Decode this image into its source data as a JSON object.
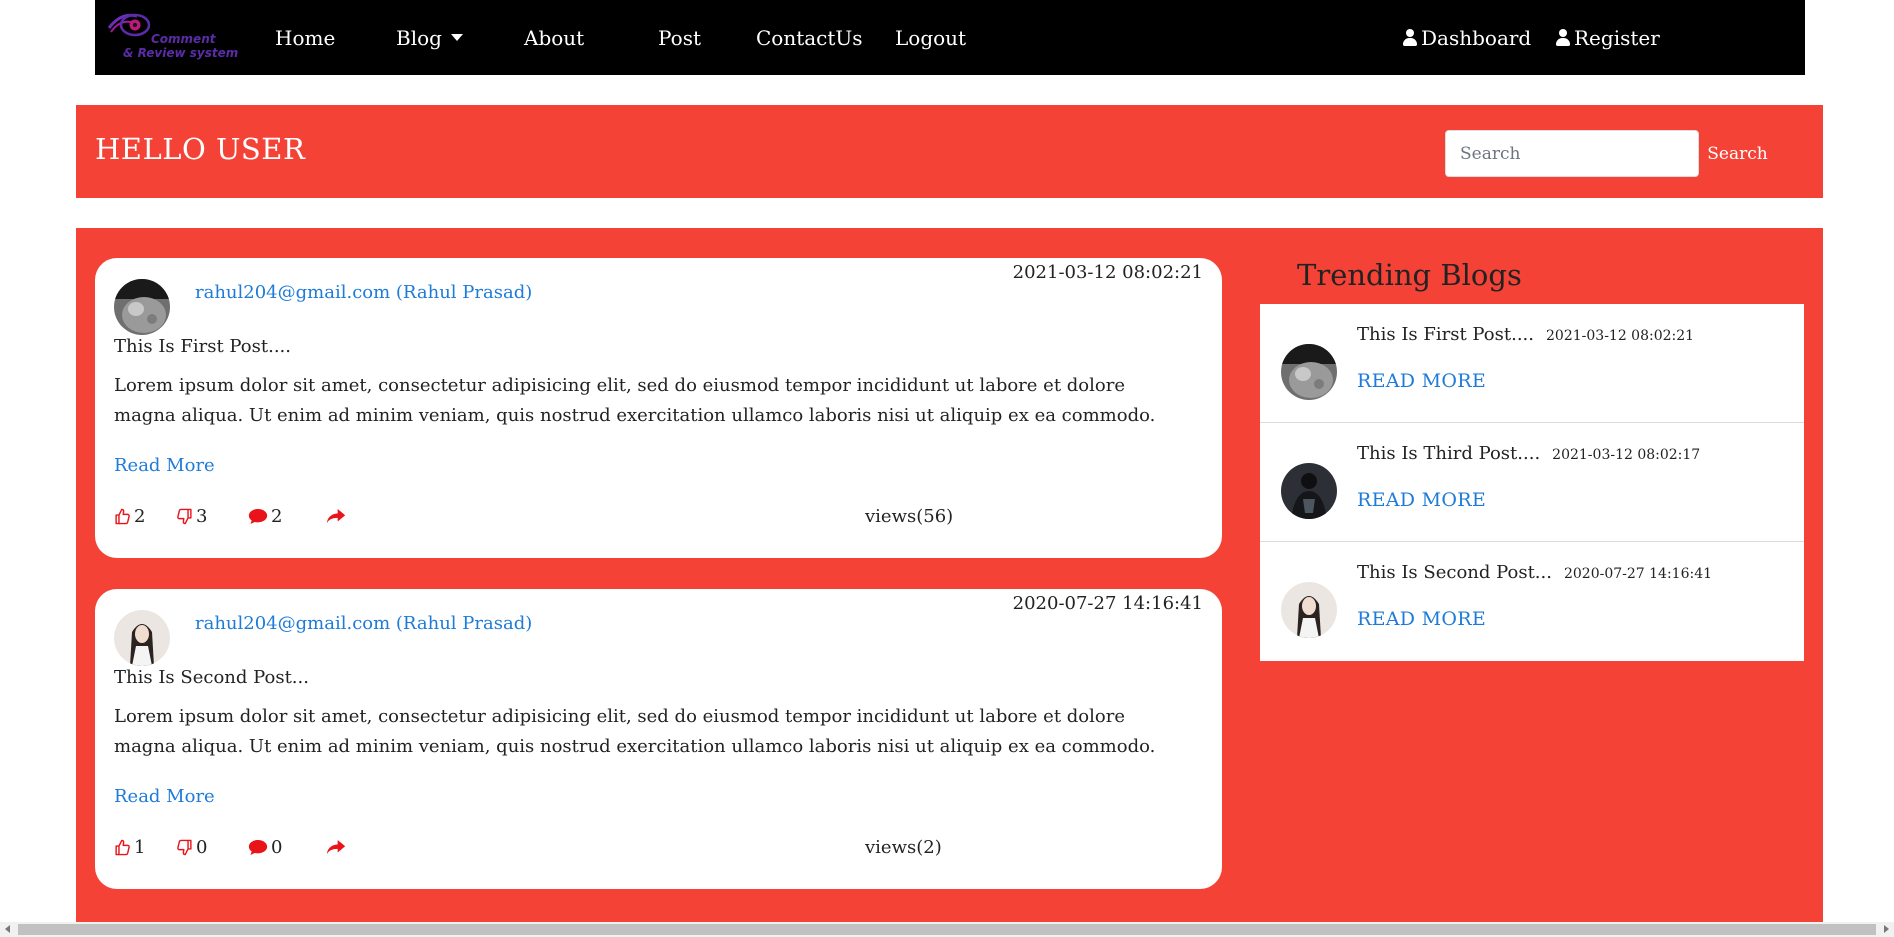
{
  "brand": {
    "line1": "Comment",
    "line2": "& Review system"
  },
  "nav": {
    "home": "Home",
    "blog": "Blog",
    "about": "About",
    "post": "Post",
    "contact": "ContactUs",
    "logout": "Logout",
    "dashboard": "Dashboard",
    "register": "Register"
  },
  "banner": {
    "greeting": "HELLO USER",
    "search_placeholder": "Search",
    "search_button": "Search"
  },
  "posts": [
    {
      "date": "2021-03-12 08:02:21",
      "author": "rahul204@gmail.com  (Rahul Prasad)",
      "title": "This Is First Post....",
      "body": "Lorem ipsum dolor sit amet, consectetur adipisicing elit, sed do eiusmod tempor incididunt ut labore et dolore magna aliqua. Ut enim ad minim veniam, quis nostrud exercitation ullamco laboris nisi ut aliquip ex ea commodo.",
      "read_more": "Read More",
      "likes": "2",
      "dislikes": "3",
      "comments": "2",
      "views": "views(56)"
    },
    {
      "date": "2020-07-27 14:16:41",
      "author": "rahul204@gmail.com  (Rahul Prasad)",
      "title": "This Is Second Post...",
      "body": "Lorem ipsum dolor sit amet, consectetur adipisicing elit, sed do eiusmod tempor incididunt ut labore et dolore magna aliqua. Ut enim ad minim veniam, quis nostrud exercitation ullamco laboris nisi ut aliquip ex ea commodo.",
      "read_more": "Read More",
      "likes": "1",
      "dislikes": "0",
      "comments": "0",
      "views": "views(2)"
    }
  ],
  "trending": {
    "title": "Trending Blogs",
    "items": [
      {
        "title": "This Is First Post....",
        "date": "2021-03-12 08:02:21",
        "read_more": "READ MORE"
      },
      {
        "title": "This Is Third Post....",
        "date": "2021-03-12 08:02:17",
        "read_more": "READ MORE"
      },
      {
        "title": "This Is Second Post...",
        "date": "2020-07-27 14:16:41",
        "read_more": "READ MORE"
      }
    ]
  },
  "colors": {
    "navbar": "#000000",
    "accent_red": "#f44336",
    "link_blue": "#1e7bd8",
    "icon_red": "#e8141a"
  },
  "icons": {
    "like": "thumbs-up-icon",
    "dislike": "thumbs-down-icon",
    "comment": "comment-icon",
    "share": "share-icon",
    "user": "user-icon"
  }
}
